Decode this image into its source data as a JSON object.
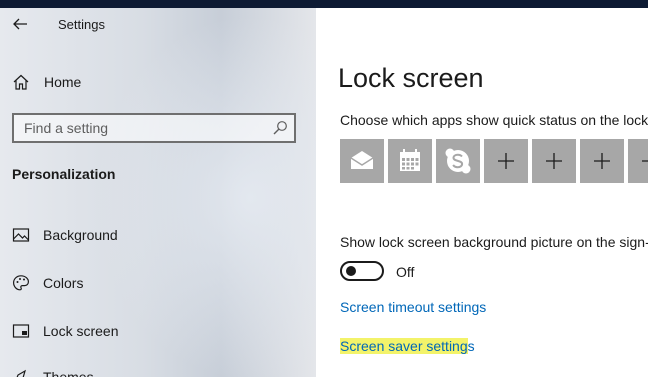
{
  "window": {
    "title": "Settings"
  },
  "sidebar": {
    "home_label": "Home",
    "search_placeholder": "Find a setting",
    "section_title": "Personalization",
    "items": [
      {
        "label": "Background",
        "icon": "image-icon"
      },
      {
        "label": "Colors",
        "icon": "palette-icon"
      },
      {
        "label": "Lock screen",
        "icon": "lock-screen-icon"
      },
      {
        "label": "Themes",
        "icon": "themes-icon"
      }
    ]
  },
  "main": {
    "title": "Lock screen",
    "quick_status_text": "Choose which apps show quick status on the lock",
    "quick_status_tiles": [
      {
        "icon": "mail-icon"
      },
      {
        "icon": "calendar-icon"
      },
      {
        "icon": "skype-icon"
      },
      {
        "icon": "plus-icon"
      },
      {
        "icon": "plus-icon"
      },
      {
        "icon": "plus-icon"
      },
      {
        "icon": "plus-icon"
      }
    ],
    "bg_picture_text": "Show lock screen background picture on the sign-",
    "toggle_state": "Off",
    "screen_timeout_link": "Screen timeout settings",
    "screen_saver_link_highlighted": "Screen saver setting",
    "screen_saver_link_rest": "s"
  },
  "colors": {
    "accent": "#0067b8",
    "tile_bg": "#a7a7a7",
    "highlight": "#f3f36a",
    "topbar": "#0d1a33"
  }
}
